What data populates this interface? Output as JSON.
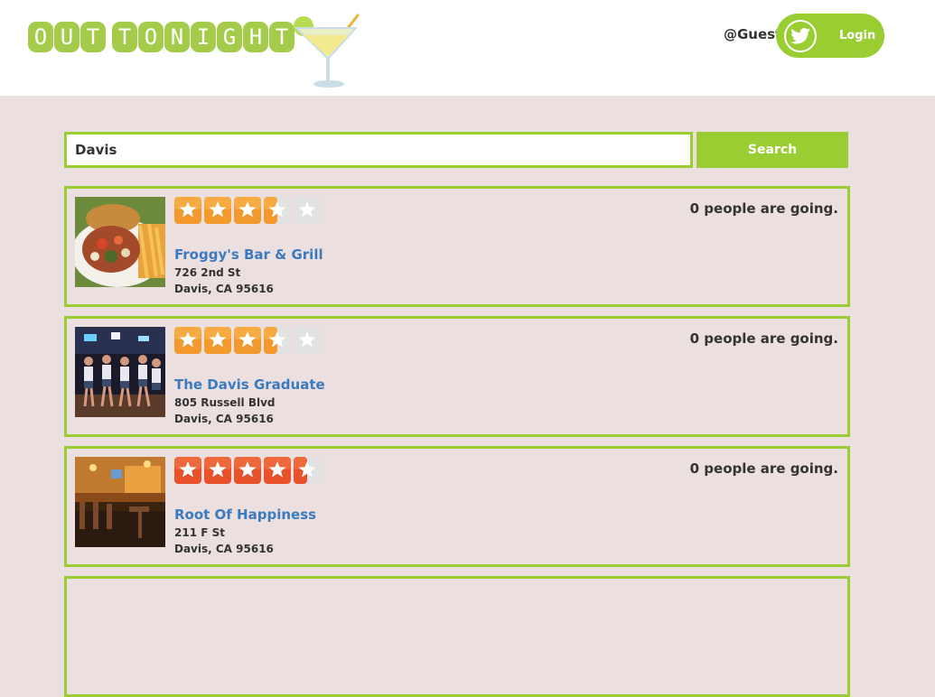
{
  "header": {
    "logo_letters": [
      "O",
      "U",
      "T",
      " ",
      "T",
      "O",
      "N",
      "I",
      "G",
      "H",
      "T"
    ],
    "user_label": "@Guest",
    "login_label": "Login"
  },
  "search": {
    "value": "Davis",
    "button_label": "Search"
  },
  "colors": {
    "accent": "#9acd32",
    "background": "#ecdfdf",
    "link": "#3a7bbf",
    "star_orange_light": "#f7a43a",
    "star_red": "#e8522a",
    "star_empty": "#e6e6e6"
  },
  "results": [
    {
      "name": "Froggy's Bar & Grill",
      "address_line1": "726 2nd St",
      "address_line2": "Davis, CA 95616",
      "rating": 3.5,
      "going_text": "0 people are going.",
      "star_style": "orange",
      "image": "food-plate-image"
    },
    {
      "name": "The Davis Graduate",
      "address_line1": "805 Russell Blvd",
      "address_line2": "Davis, CA 95616",
      "rating": 3.5,
      "going_text": "0 people are going.",
      "star_style": "orange",
      "image": "dancers-image"
    },
    {
      "name": "Root Of Happiness",
      "address_line1": "211 F St",
      "address_line2": "Davis, CA 95616",
      "rating": 4.5,
      "going_text": "0 people are going.",
      "star_style": "red",
      "image": "bar-interior-image"
    }
  ]
}
